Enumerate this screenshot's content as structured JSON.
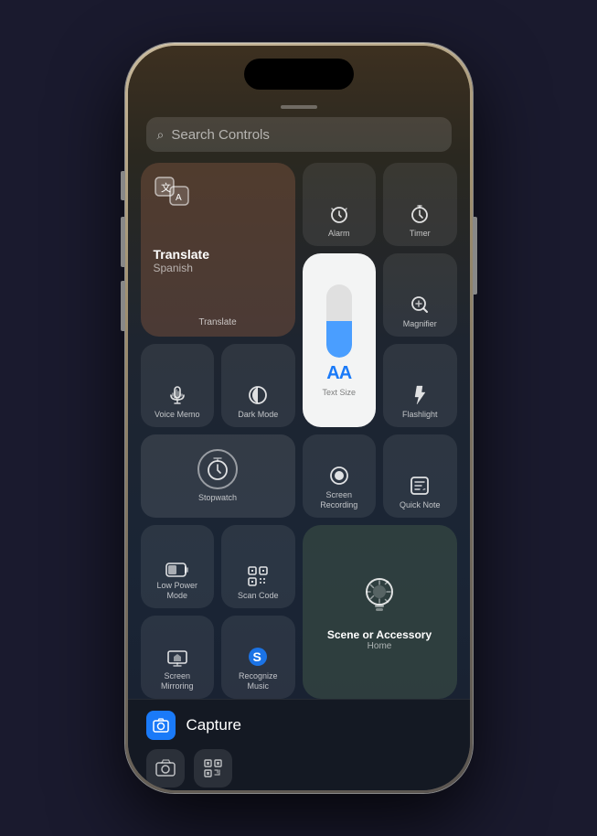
{
  "phone": {
    "search": {
      "placeholder": "Search Controls",
      "icon": "🔍"
    },
    "controls": {
      "translate": {
        "label": "Translate",
        "sublabel": "Spanish",
        "icon": "🌐"
      },
      "alarm": {
        "label": "Alarm"
      },
      "timer": {
        "label": "Timer"
      },
      "magnifier": {
        "label": "Magnifier"
      },
      "textSize": {
        "label": "Text Size",
        "aa": "AA"
      },
      "voiceMemo": {
        "label": "Voice Memo"
      },
      "darkMode": {
        "label": "Dark Mode"
      },
      "flashlight": {
        "label": "Flashlight"
      },
      "stopwatch": {
        "label": "Stopwatch"
      },
      "screenRecording": {
        "label": "Screen\nRecording"
      },
      "quickNote": {
        "label": "Quick Note"
      },
      "lowPower": {
        "label": "Low Power\nMode"
      },
      "scanCode": {
        "label": "Scan Code"
      },
      "scene": {
        "label": "Scene or Accessory",
        "sublabel": "Home"
      },
      "screenMirroring": {
        "label": "Screen\nMirroring"
      },
      "recognizeMusic": {
        "label": "Recognize\nMusic"
      }
    },
    "bottom": {
      "capture": "Capture"
    }
  }
}
